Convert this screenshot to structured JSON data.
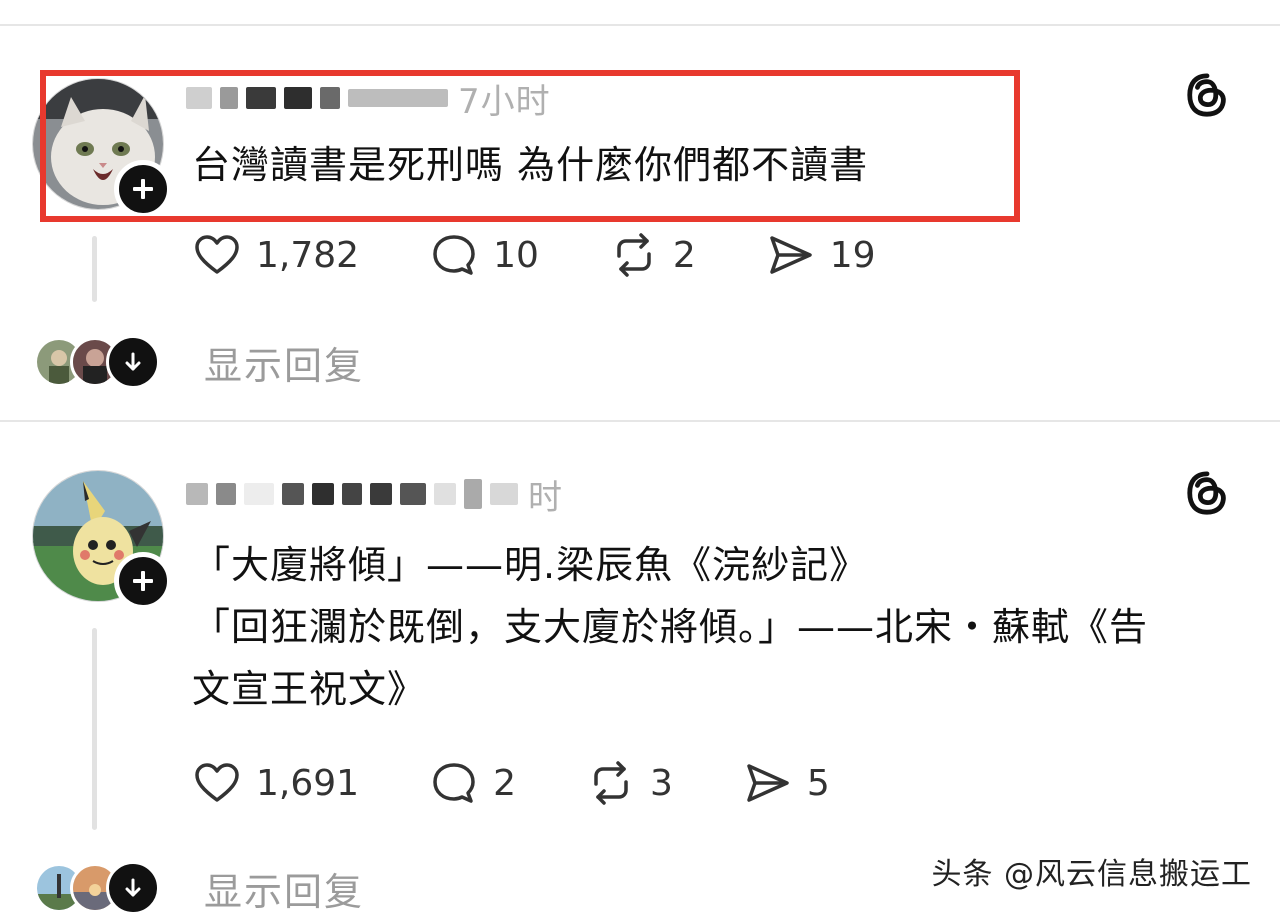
{
  "posts": [
    {
      "time": "7小时",
      "lines": [
        "台灣讀書是死刑嗎 為什麼你們都不讀書"
      ],
      "actions": {
        "likes": "1,782",
        "comments": "10",
        "reposts": "2",
        "shares": "19"
      },
      "show_replies": "显示回复",
      "avatar_icon": "cat-avatar-icon",
      "highlighted": true
    },
    {
      "time": "时",
      "lines": [
        "「大廈將傾」——明.梁辰魚《浣紗記》",
        "「回狂瀾於既倒，支大廈於將傾。」——北宋・蘇軾《告",
        "文宣王祝文》"
      ],
      "actions": {
        "likes": "1,691",
        "comments": "2",
        "reposts": "3",
        "shares": "5"
      },
      "show_replies": "显示回复",
      "avatar_icon": "mimikyu-avatar-icon",
      "highlighted": false
    }
  ],
  "watermark": "头条 @风云信息搬运工",
  "colors": {
    "highlight": "#e8392e",
    "muted_text": "#9b9b9b",
    "line": "#e2e2e2"
  }
}
